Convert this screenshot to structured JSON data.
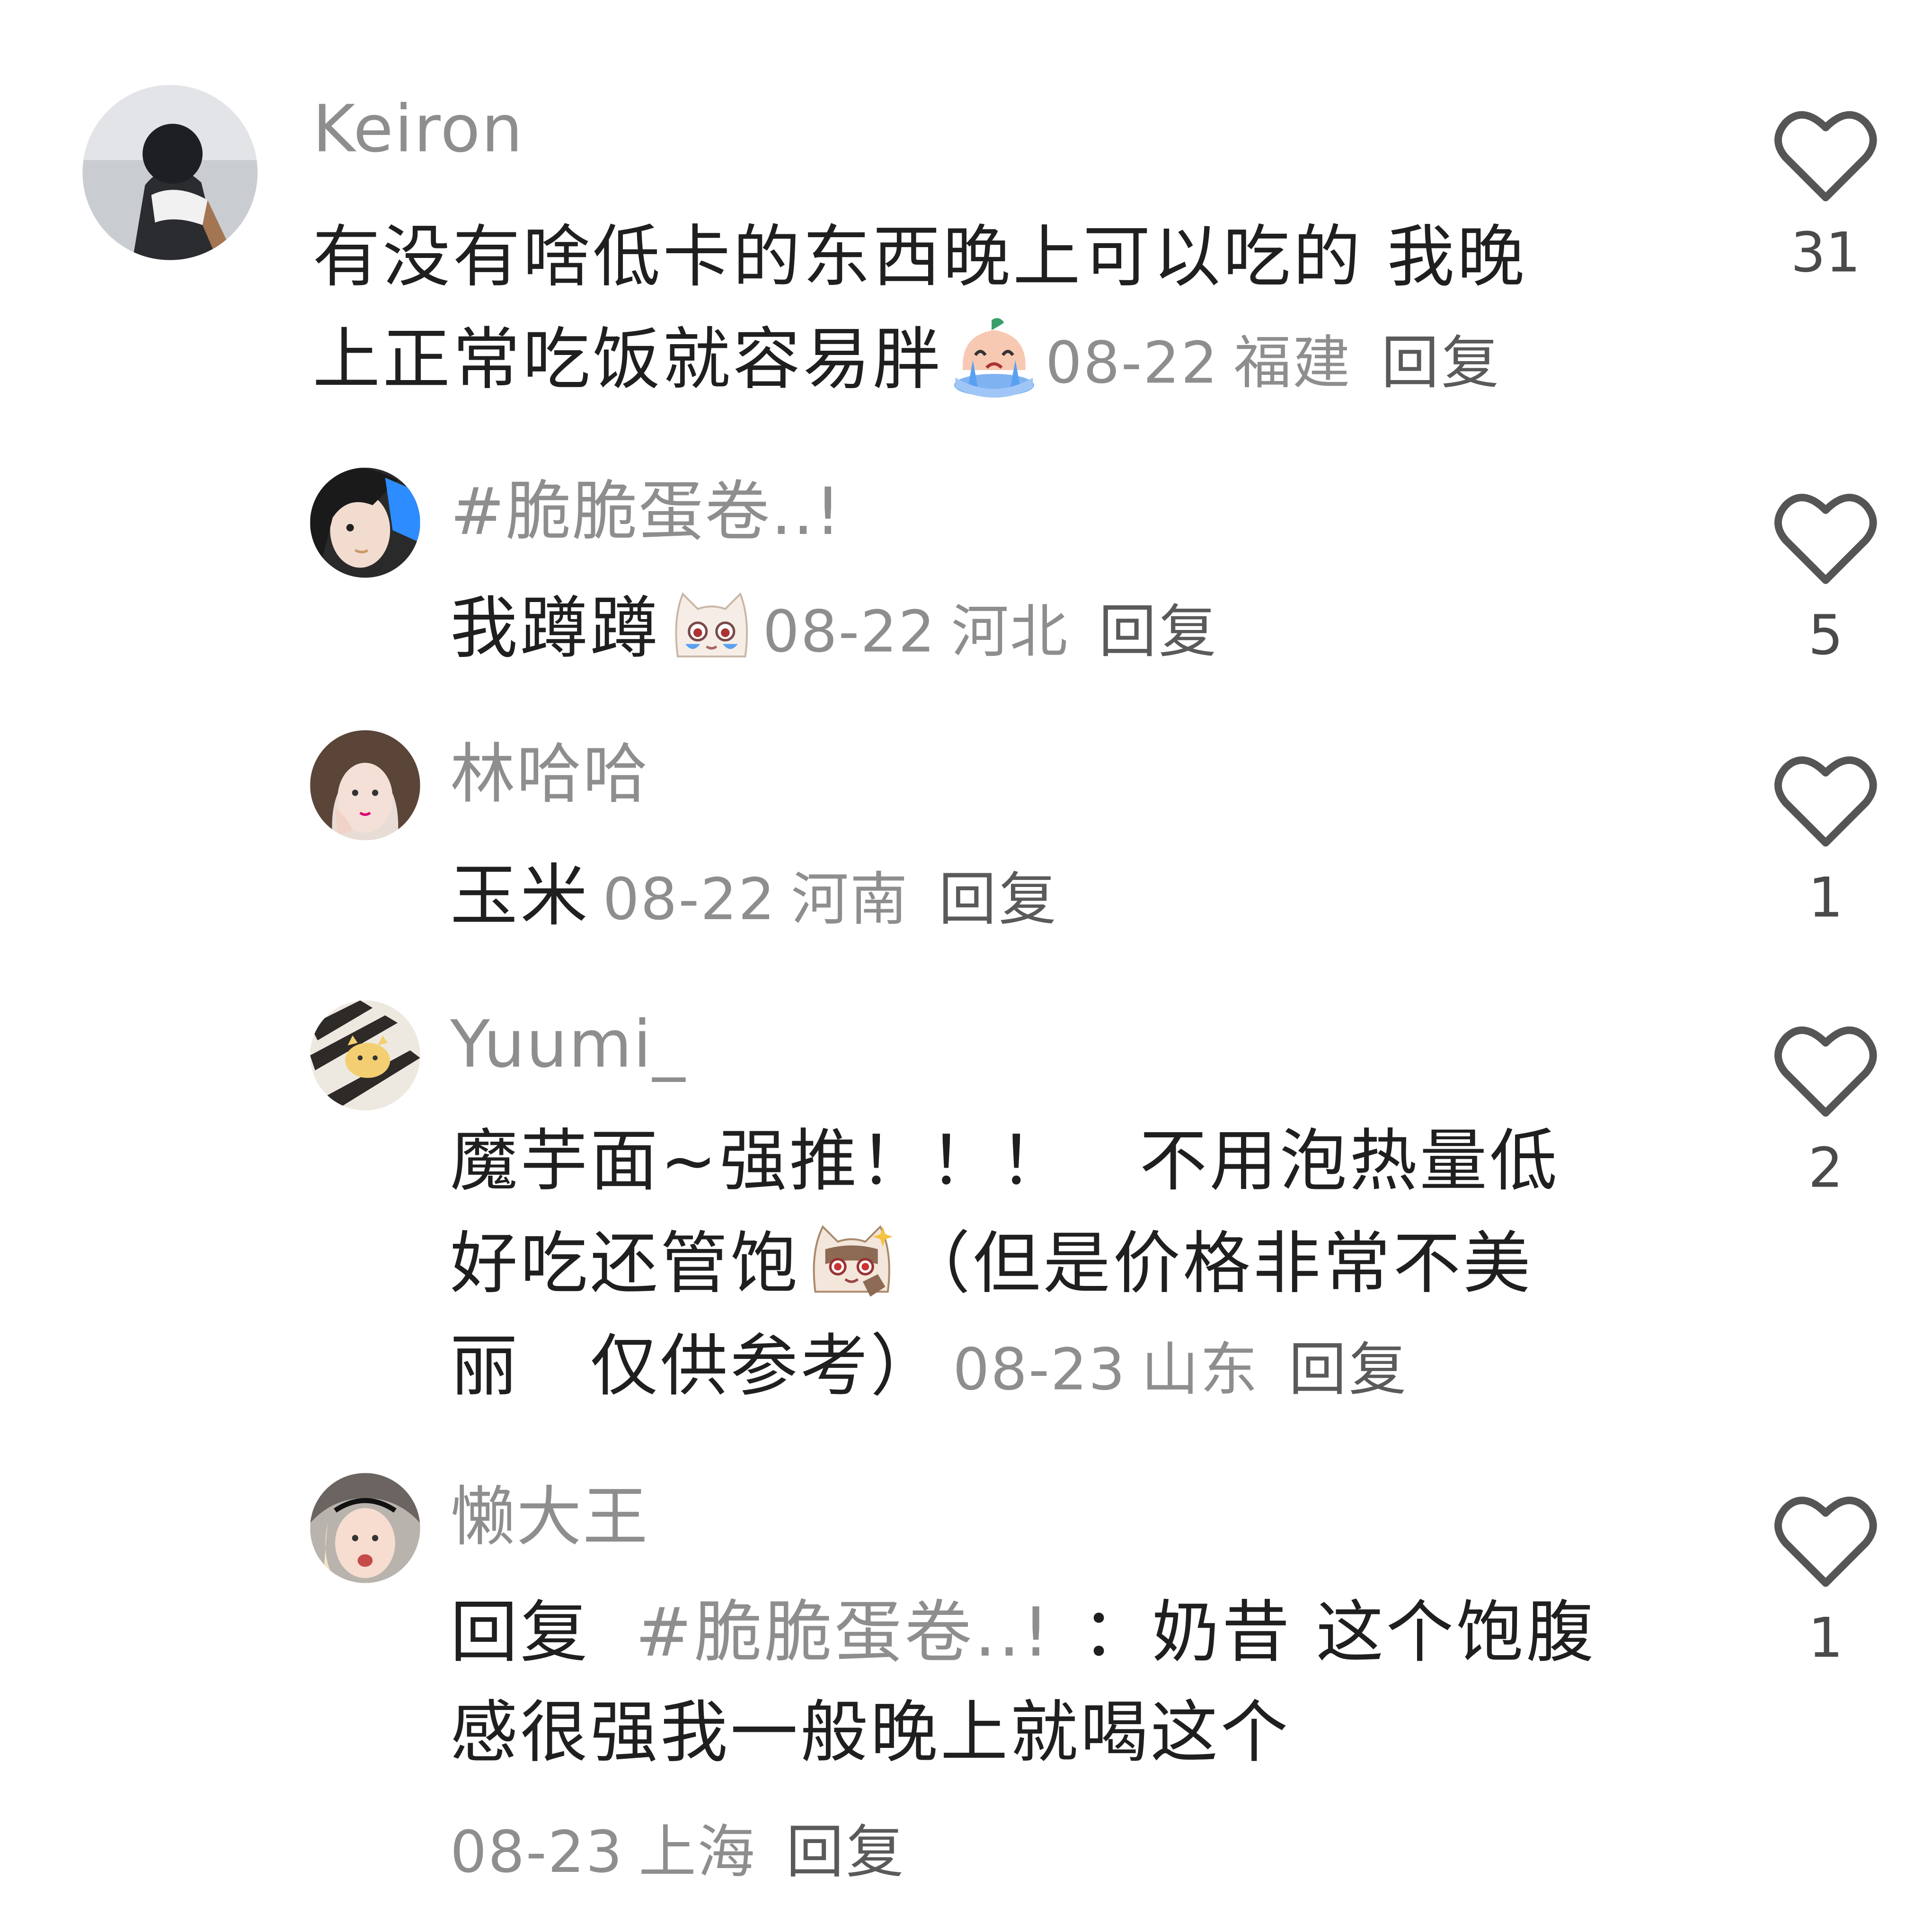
{
  "comments": [
    {
      "user": "Keiron",
      "line1": "有没有啥低卡的东西晚上可以吃的 我晚",
      "line2": "上正常吃饭就容易胖",
      "emoji": "crying-peach-emoji",
      "date": "08-22",
      "location": "福建",
      "reply": "回复",
      "likes": "31"
    },
    {
      "user": "#脆脆蛋卷..!",
      "line1": "我蹲蹲",
      "emoji": "crying-cat-emoji",
      "date": "08-22",
      "location": "河北",
      "reply": "回复",
      "likes": "5"
    },
    {
      "user": "林哈哈",
      "line1": "玉米",
      "date": "08-22",
      "location": "河南",
      "reply": "回复",
      "likes": "1"
    },
    {
      "user": "Yuumi_",
      "line1": "魔芋面~强推！！！　不用泡热量低",
      "line2": "好吃还管饱",
      "line2b": "（但是价格非常不美",
      "line3": "丽　仅供参考）",
      "emoji": "thumbs-up-cat-emoji",
      "date": "08-23",
      "location": "山东",
      "reply": "回复",
      "likes": "2"
    },
    {
      "user": "懒大王",
      "reply_prefix": "回复",
      "reply_target": "#脆脆蛋卷..!",
      "colon": "：",
      "line1": "奶昔 这个饱腹",
      "line2": "感很强我一般晚上就喝这个",
      "date": "08-23",
      "location": "上海",
      "reply": "回复",
      "likes": "1"
    }
  ],
  "colors": {
    "username": "#8e8e8e",
    "text": "#1f1f1f",
    "meta": "#8e8e8e",
    "icon": "#555555"
  }
}
